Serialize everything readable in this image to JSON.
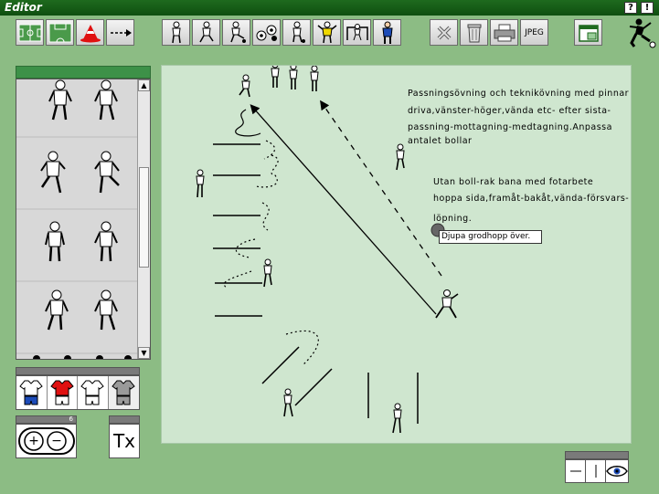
{
  "window": {
    "title": "Editor",
    "help_label": "?",
    "alert_label": "!"
  },
  "toolbar": {
    "groups": [
      {
        "name": "field-tools",
        "icons": [
          "field-full-icon",
          "field-half-icon",
          "cone-icon",
          "arrow-tool-icon"
        ]
      },
      {
        "name": "player-tools",
        "icons": [
          "player-standing-icon",
          "player-running-icon",
          "player-kicking-icon",
          "balls-icon",
          "player-dribbling-icon",
          "goalkeeper-icon",
          "goal-icon",
          "coach-icon"
        ]
      },
      {
        "name": "edit-tools",
        "icons": [
          "delete-icon",
          "trash-icon",
          "print-icon"
        ]
      }
    ],
    "jpeg_label": "JPEG",
    "accent_color": "#1e6a1e"
  },
  "library": {
    "rows": 4,
    "scroll_up": "▲",
    "scroll_down": "▼"
  },
  "jerseys": [
    {
      "name": "white-blue",
      "shirt": "#ffffff",
      "shorts": "#1c4bb8"
    },
    {
      "name": "red-white",
      "shirt": "#e01010",
      "shorts": "#ffffff"
    },
    {
      "name": "white-white",
      "shirt": "#ffffff",
      "shorts": "#ffffff"
    },
    {
      "name": "grey-grey",
      "shirt": "#9a9a9a",
      "shorts": "#9a9a9a"
    }
  ],
  "zoom": {
    "level": "6",
    "plus": "+",
    "minus": "−"
  },
  "text_tool": {
    "label": "Tx"
  },
  "field": {
    "background": "#cfe6cf",
    "notes": [
      "Passningsövning och teknikövning med pinnar",
      "driva,vänster-höger,vända etc- efter sista-",
      "passning-mottagning-medtagning.Anpassa",
      " antalet bollar"
    ],
    "notes2": [
      "Utan boll-rak bana med fotarbete",
      " hoppa sida,framåt-bakåt,vända-försvars-",
      "löpning."
    ],
    "tooltip": "Djupa grodhopp över."
  },
  "view_box": {
    "eye_icon": "eye-icon"
  }
}
